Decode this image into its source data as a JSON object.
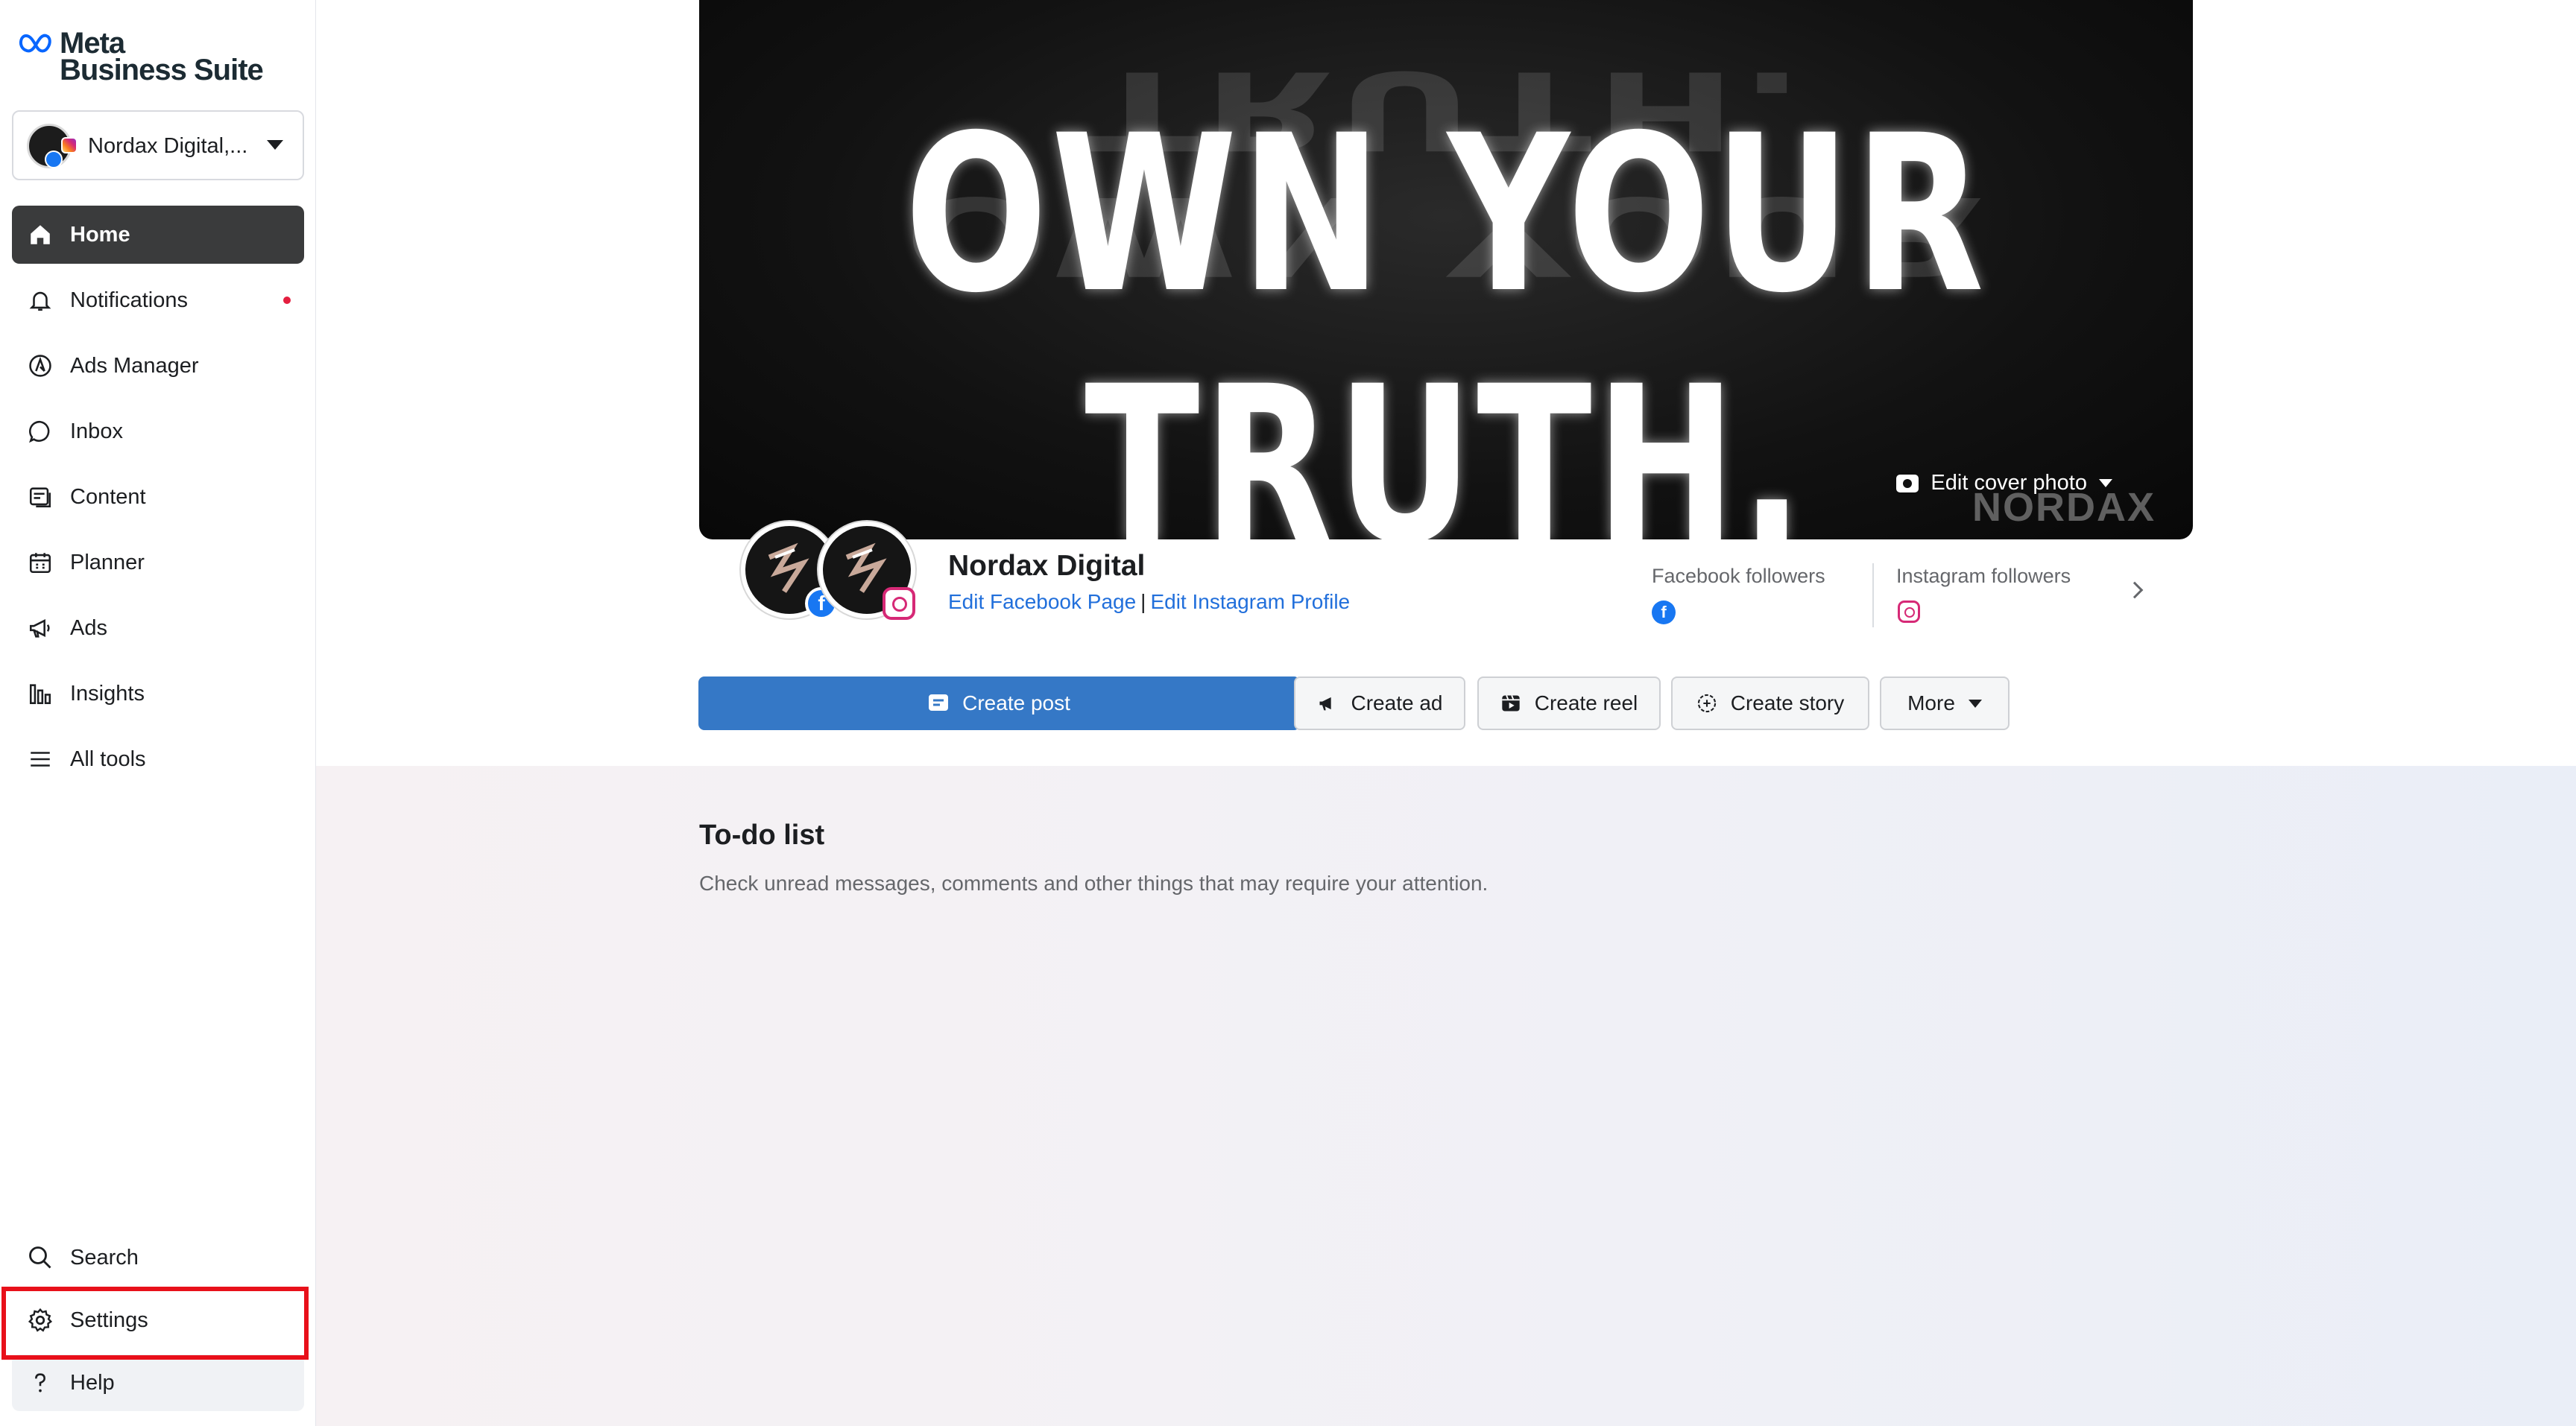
{
  "app": {
    "brand_line1": "Meta",
    "brand_line2": "Business Suite"
  },
  "account": {
    "name": "Nordax Digital,..."
  },
  "sidebar": {
    "items": [
      {
        "label": "Home",
        "icon": "home-icon",
        "active": true
      },
      {
        "label": "Notifications",
        "icon": "bell-icon",
        "has_dot": true
      },
      {
        "label": "Ads Manager",
        "icon": "ads-manager-icon"
      },
      {
        "label": "Inbox",
        "icon": "chat-bubble-icon"
      },
      {
        "label": "Content",
        "icon": "content-icon"
      },
      {
        "label": "Planner",
        "icon": "calendar-icon"
      },
      {
        "label": "Ads",
        "icon": "megaphone-icon"
      },
      {
        "label": "Insights",
        "icon": "bar-chart-icon"
      },
      {
        "label": "All tools",
        "icon": "menu-icon"
      }
    ],
    "bottom": [
      {
        "label": "Search",
        "icon": "search-icon"
      },
      {
        "label": "Settings",
        "icon": "gear-icon",
        "highlighted": true
      },
      {
        "label": "Help",
        "icon": "question-icon"
      }
    ]
  },
  "cover": {
    "headline": "OWN YOUR TRUTH.",
    "edit_label": "Edit cover photo",
    "watermark": "NORDAX"
  },
  "profile": {
    "name": "Nordax Digital",
    "edit_facebook": "Edit Facebook Page",
    "separator": "|",
    "edit_instagram": "Edit Instagram Profile"
  },
  "followers": {
    "facebook_label": "Facebook followers",
    "instagram_label": "Instagram followers"
  },
  "actions": {
    "create_post": "Create post",
    "create_ad": "Create ad",
    "create_reel": "Create reel",
    "create_story": "Create story",
    "more": "More"
  },
  "todo": {
    "title": "To-do list",
    "subtitle": "Check unread messages, comments and other things that may require your attention."
  },
  "colors": {
    "primary_button": "#3578c6",
    "link": "#216fdb",
    "highlight_box": "#e8101a",
    "notification_dot": "#e41e3f"
  }
}
